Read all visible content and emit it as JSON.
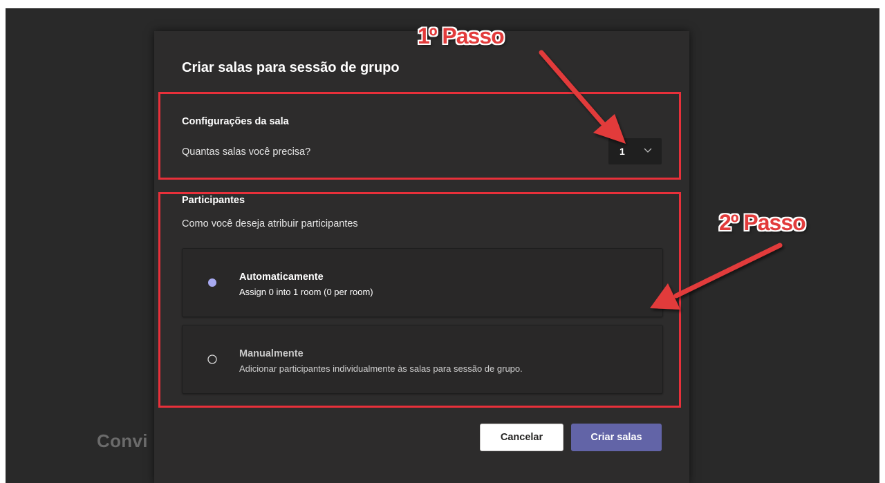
{
  "background": {
    "partial_text": "Convi"
  },
  "dialog": {
    "title": "Criar salas para sessão de grupo",
    "room_settings": {
      "heading": "Configurações da sala",
      "question": "Quantas salas você precisa?",
      "rooms_value": "1"
    },
    "participants": {
      "heading": "Participantes",
      "question": "Como você deseja atribuir participantes",
      "options": [
        {
          "title": "Automaticamente",
          "subtitle": "Assign 0 into 1 room (0 per room)",
          "selected": true
        },
        {
          "title": "Manualmente",
          "subtitle": "Adicionar participantes individualmente às salas para sessão de grupo.",
          "selected": false
        }
      ]
    },
    "buttons": {
      "cancel": "Cancelar",
      "create": "Criar salas"
    }
  },
  "annotations": {
    "step1": "1º Passo",
    "step2": "2º Passo"
  },
  "colors": {
    "accent": "#6264a7",
    "radio_selected": "#a7a9f0",
    "annotation_red": "#e23b3b",
    "dialog_bg": "#2d2c2c"
  },
  "icons": {
    "dropdown": "chevron-down-icon",
    "radio_on": "radio-selected-icon",
    "radio_off": "radio-unselected-icon"
  }
}
